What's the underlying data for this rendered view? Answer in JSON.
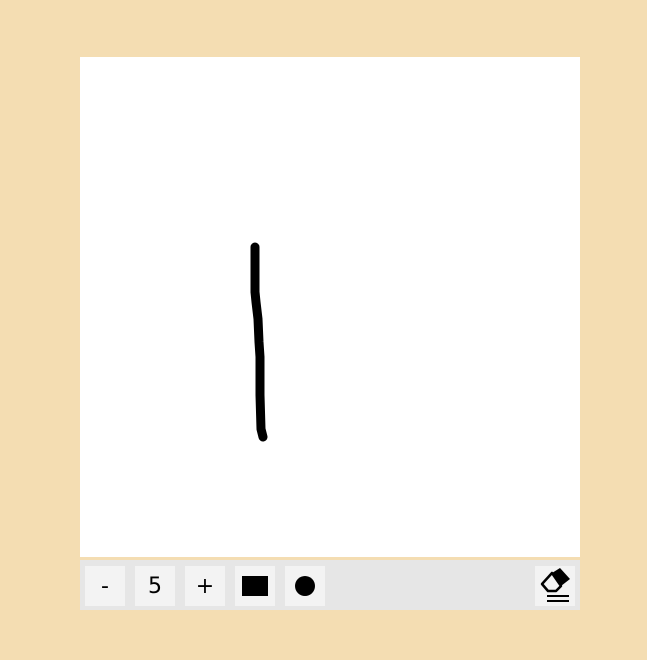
{
  "colors": {
    "page_background": "#f4ddb2",
    "canvas_background": "#ffffff",
    "toolbar_background": "#e6e6e6",
    "button_background": "#f3f3f3",
    "stroke_color": "#000000"
  },
  "toolbar": {
    "decrease_label": "-",
    "brush_size_value": "5",
    "increase_label": "+",
    "color_swatch_icon": "square-color-swatch-icon",
    "brush_shape_icon": "round-brush-icon",
    "eraser_icon": "eraser-icon"
  }
}
